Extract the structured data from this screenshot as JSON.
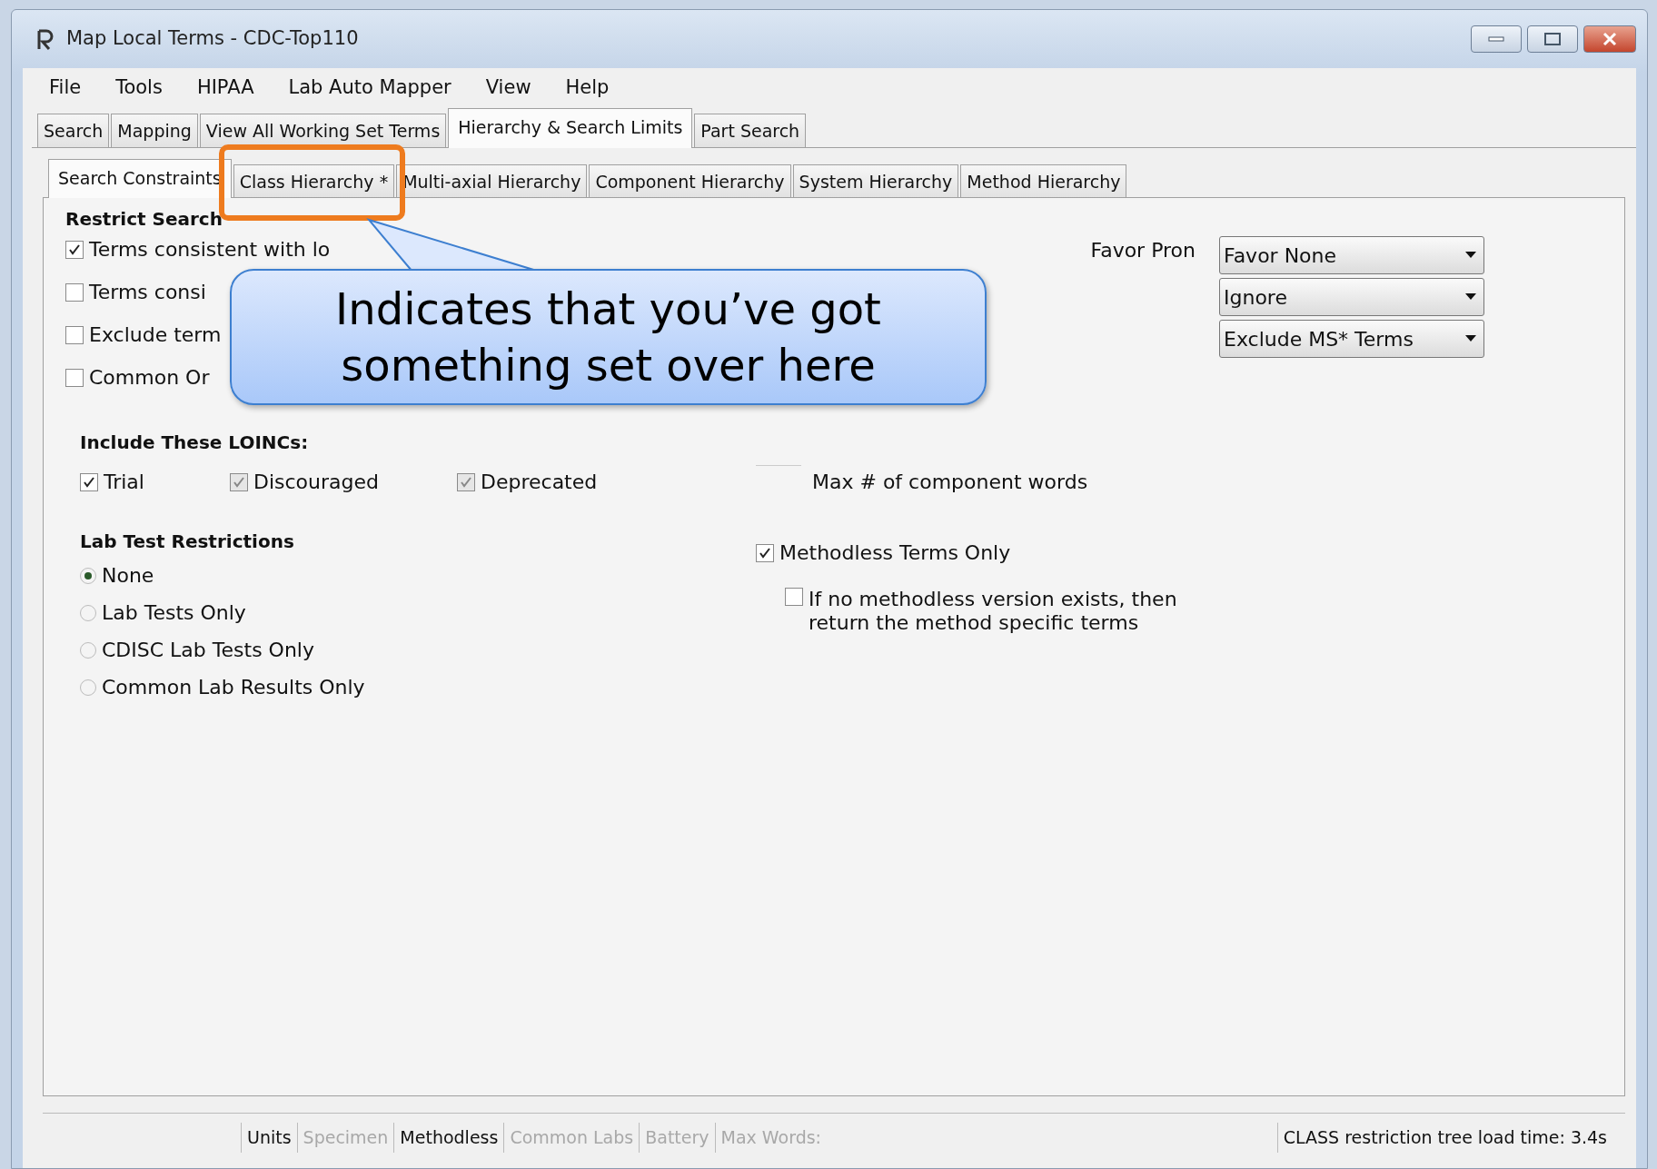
{
  "window": {
    "title": "Map Local Terms - CDC-Top110"
  },
  "menu": [
    "File",
    "Tools",
    "HIPAA",
    "Lab Auto Mapper",
    "View",
    "Help"
  ],
  "tabs": [
    {
      "label": "Search",
      "selected": false
    },
    {
      "label": "Mapping",
      "selected": false
    },
    {
      "label": "View All Working Set Terms",
      "selected": false
    },
    {
      "label": "Hierarchy & Search Limits",
      "selected": true
    },
    {
      "label": "Part Search",
      "selected": false
    }
  ],
  "subtabs": [
    {
      "label": "Search Constraints",
      "selected": true,
      "highlighted": false
    },
    {
      "label": "Class Hierarchy *",
      "selected": false,
      "highlighted": true
    },
    {
      "label": "Multi-axial Hierarchy",
      "selected": false,
      "highlighted": false
    },
    {
      "label": "Component Hierarchy",
      "selected": false,
      "highlighted": false
    },
    {
      "label": "System Hierarchy",
      "selected": false,
      "highlighted": false
    },
    {
      "label": "Method Hierarchy",
      "selected": false,
      "highlighted": false
    }
  ],
  "restrict_search": {
    "title": "Restrict Search",
    "options": [
      {
        "label": "Terms consistent with lo",
        "checked": true
      },
      {
        "label": "Terms consi",
        "checked": false
      },
      {
        "label": "Exclude term",
        "checked": false
      },
      {
        "label": "Common Or",
        "checked": false
      }
    ]
  },
  "preferences": {
    "label": "Favor Pron",
    "dropdowns": [
      "Favor None",
      "Ignore",
      "Exclude MS* Terms"
    ]
  },
  "include_loincs": {
    "title": "Include These LOINCs:",
    "options": [
      {
        "label": "Trial",
        "checked": true,
        "disabled": false
      },
      {
        "label": "Discouraged",
        "checked": true,
        "disabled": true
      },
      {
        "label": "Deprecated",
        "checked": true,
        "disabled": true
      }
    ]
  },
  "lab_test_restrictions": {
    "title": "Lab Test Restrictions",
    "options": [
      {
        "label": "None",
        "selected": true
      },
      {
        "label": "Lab Tests Only",
        "selected": false
      },
      {
        "label": "CDISC Lab Tests Only",
        "selected": false
      },
      {
        "label": "Common Lab Results Only",
        "selected": false
      }
    ]
  },
  "max_words": {
    "label": "Max # of component words"
  },
  "methodless": {
    "label": "Methodless Terms Only",
    "checked": true,
    "sub_option": {
      "label": "If no methodless version exists, then return the method specific terms",
      "checked": false
    }
  },
  "callout": {
    "text": "Indicates that you’ve got something set over here"
  },
  "status_bar": {
    "items": [
      {
        "label": "Units",
        "disabled": false
      },
      {
        "label": "Specimen",
        "disabled": true
      },
      {
        "label": "Methodless",
        "disabled": false
      },
      {
        "label": "Common Labs",
        "disabled": true
      },
      {
        "label": "Battery",
        "disabled": true
      },
      {
        "label": "Max Words:",
        "disabled": true
      }
    ],
    "message": "CLASS restriction tree load time: 3.4s"
  }
}
